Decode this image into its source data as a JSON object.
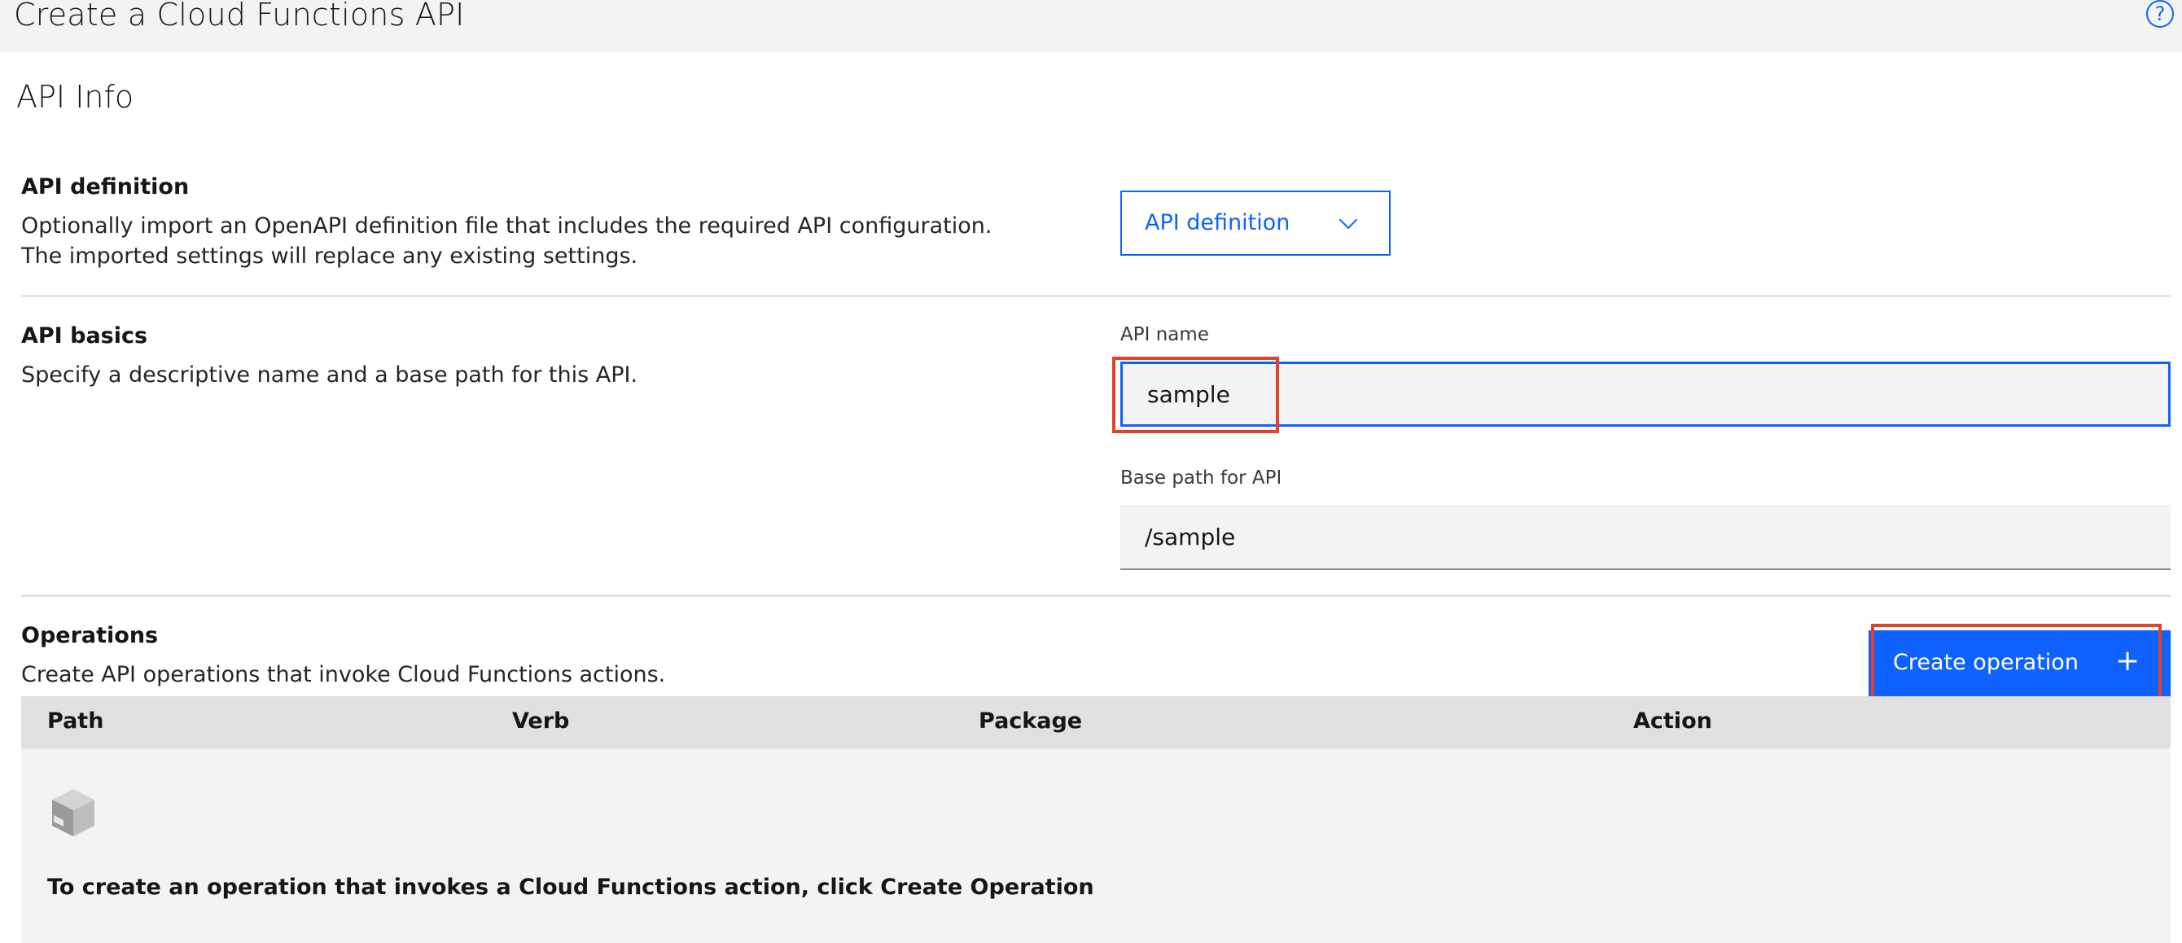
{
  "header": {
    "title": "Create a Cloud Functions API",
    "help_icon": "?"
  },
  "api_info": {
    "title": "API Info",
    "definition": {
      "title": "API definition",
      "description": "Optionally import an OpenAPI definition file that includes the required API configuration. The imported settings will replace any existing settings.",
      "dropdown_label": "API definition"
    },
    "basics": {
      "title": "API basics",
      "description": "Specify a descriptive name and a base path for this API.",
      "api_name_label": "API name",
      "api_name_value": "sample",
      "base_path_label": "Base path for API",
      "base_path_value": "/sample"
    }
  },
  "operations": {
    "title": "Operations",
    "description": "Create API operations that invoke Cloud Functions actions.",
    "create_button_label": "Create operation",
    "create_button_icon": "+",
    "columns": [
      "Path",
      "Verb",
      "Package",
      "Action"
    ],
    "empty_message": "To create an operation that invokes a Cloud Functions action, click Create Operation"
  },
  "colors": {
    "accent": "#0f62fe",
    "highlight": "#e24227",
    "header_bg": "#f3f3f3"
  }
}
